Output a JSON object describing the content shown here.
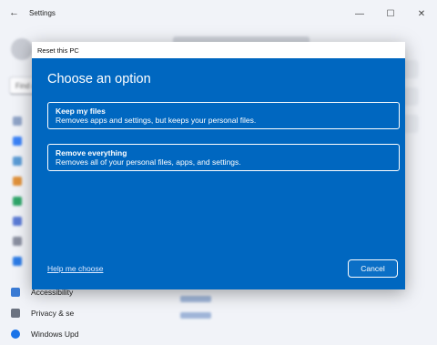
{
  "window": {
    "title": "Settings",
    "back_icon": "←",
    "minimize_icon": "—",
    "maximize_icon": "☐",
    "close_icon": "✕"
  },
  "sidebar": {
    "search_placeholder": "Find a",
    "items": [
      {
        "label": "Accessibility",
        "icon": "accessibility-icon",
        "color": "#3a7bd5"
      },
      {
        "label": "Privacy & se",
        "icon": "shield-icon",
        "color": "#6b7280"
      },
      {
        "label": "Windows Upd",
        "icon": "update-icon",
        "color": "#1a73e8"
      }
    ]
  },
  "dialog": {
    "title": "Reset this PC",
    "heading": "Choose an option",
    "options": [
      {
        "title": "Keep my files",
        "description": "Removes apps and settings, but keeps your personal files."
      },
      {
        "title": "Remove everything",
        "description": "Removes all of your personal files, apps, and settings."
      }
    ],
    "help_link": "Help me choose",
    "cancel_label": "Cancel",
    "accent_color": "#0067c0"
  }
}
